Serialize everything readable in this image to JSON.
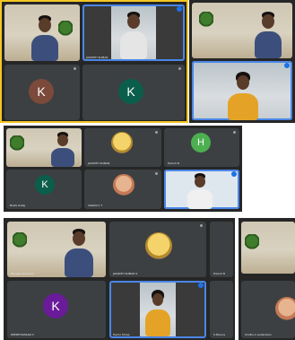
{
  "screenshot_1": {
    "tiles": [
      {
        "label": "",
        "avatar": "person"
      },
      {
        "label": "JAYANTH KUMAR",
        "avatar": "person"
      },
      {
        "label": "",
        "avatar": "letter",
        "letter": "K",
        "color": "#7b4a3a"
      },
      {
        "label": "",
        "avatar": "letter",
        "letter": "K",
        "color": "#0b5e4b"
      }
    ]
  },
  "screenshot_2": {
    "tiles": [
      {
        "label": "",
        "avatar": "person"
      },
      {
        "label": "",
        "avatar": "person"
      }
    ]
  },
  "screenshot_3": {
    "tiles": [
      {
        "label": "",
        "avatar": "person"
      },
      {
        "label": "JAYANTH KUMAR",
        "avatar": "emoji"
      },
      {
        "label": "Harish N",
        "avatar": "letter",
        "letter": "H",
        "color": "#4caf50"
      },
      {
        "label": "Boshi Kollaj",
        "avatar": "letter",
        "letter": "K",
        "color": "#0b5e4b"
      },
      {
        "label": "VARUN V T",
        "avatar": "emoji"
      },
      {
        "label": "",
        "avatar": "person"
      }
    ]
  },
  "screenshot_4": {
    "tiles": [
      {
        "label": "Naveen Kumaran",
        "avatar": "person"
      },
      {
        "label": "JAYANTH KUMAR S",
        "avatar": "emoji"
      },
      {
        "label": "Harish N",
        "avatar": "none"
      },
      {
        "label": "KEERTHIVASAN V",
        "avatar": "letter",
        "letter": "K",
        "color": "#6a1b9a"
      },
      {
        "label": "Harini Shree",
        "avatar": "person"
      },
      {
        "label": "S.Mouna",
        "avatar": "none"
      }
    ]
  },
  "screenshot_5": {
    "tiles": [
      {
        "label": "Sindhu k sudarshan",
        "avatar": "person"
      }
    ]
  },
  "colors": {
    "meet_dark": "#3c4043",
    "yellow_frame": "#f3c623",
    "speaking_blue": "#1a73e8"
  }
}
